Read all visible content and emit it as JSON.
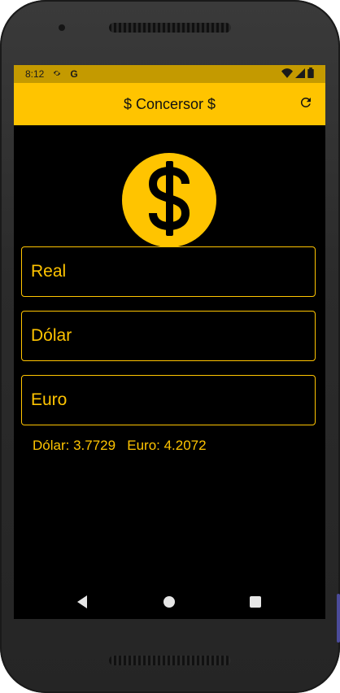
{
  "status_bar": {
    "time": "8:12",
    "icons": [
      "settings-icon",
      "google-g-icon",
      "wifi-icon",
      "signal-icon",
      "battery-icon"
    ],
    "g_letter": "G"
  },
  "app_bar": {
    "title": "$ Concersor $",
    "refresh_icon": "refresh-icon"
  },
  "logo": {
    "icon": "dollar-sign-icon",
    "symbol": "$"
  },
  "fields": {
    "real": {
      "placeholder": "Real",
      "value": ""
    },
    "dolar": {
      "placeholder": "Dólar",
      "value": ""
    },
    "euro": {
      "placeholder": "Euro",
      "value": ""
    }
  },
  "rates": {
    "text": "Dólar: 3.7729   Euro: 4.2072"
  },
  "nav_bar": {
    "icons": [
      "back-icon",
      "home-icon",
      "recents-icon"
    ]
  },
  "colors": {
    "accent": "#ffc400",
    "status_bar": "#c49a00",
    "background": "#000000"
  }
}
